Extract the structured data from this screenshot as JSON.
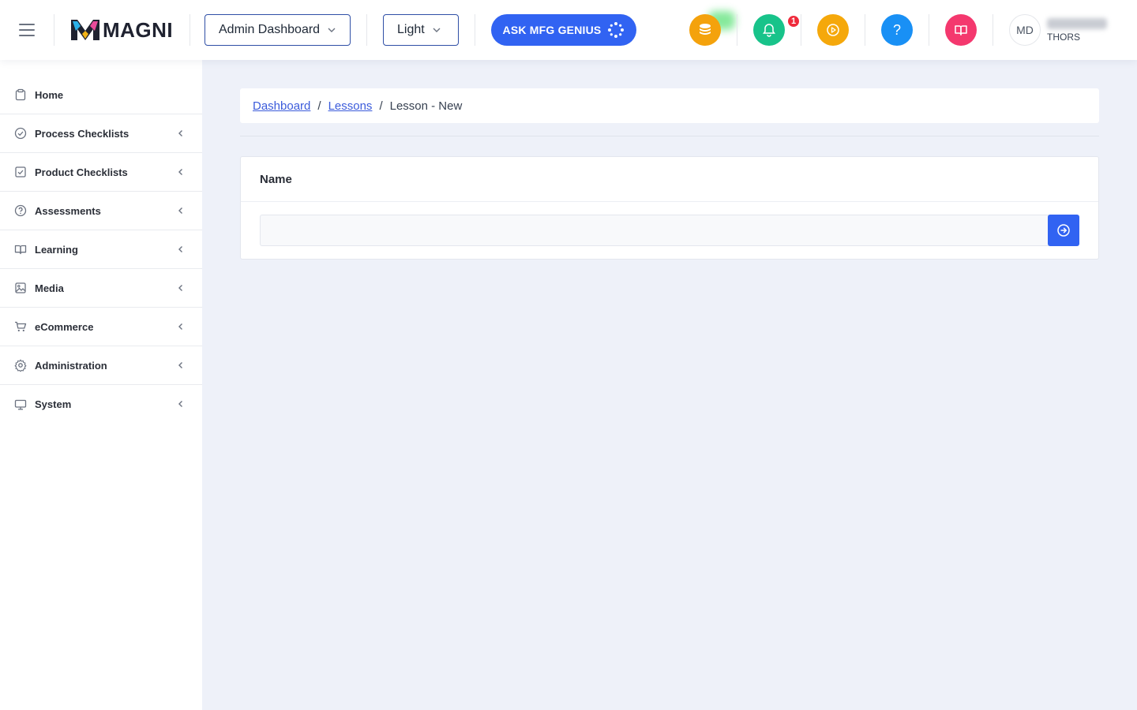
{
  "header": {
    "logo_text": "MAGNI",
    "dashboard_select": "Admin Dashboard",
    "theme_select": "Light",
    "ask_button": "ASK MFG GENIUS",
    "notification_count": "1",
    "help_glyph": "?",
    "user": {
      "initials": "MD",
      "org": "THORS"
    },
    "colors": {
      "coins": "#f4a20c",
      "bell": "#18c38a",
      "play": "#f5a80b",
      "help": "#1990f5",
      "book": "#f4386e",
      "accent": "#3163f2"
    }
  },
  "sidebar": {
    "items": [
      {
        "label": "Home",
        "icon": "clipboard-icon"
      },
      {
        "label": "Process Checklists",
        "icon": "check-circle-icon"
      },
      {
        "label": "Product Checklists",
        "icon": "check-square-icon"
      },
      {
        "label": "Assessments",
        "icon": "question-circle-icon"
      },
      {
        "label": "Learning",
        "icon": "book-open-icon"
      },
      {
        "label": "Media",
        "icon": "image-icon"
      },
      {
        "label": "eCommerce",
        "icon": "cart-icon"
      },
      {
        "label": "Administration",
        "icon": "gear-icon"
      },
      {
        "label": "System",
        "icon": "monitor-icon"
      }
    ]
  },
  "breadcrumb": {
    "items": [
      "Dashboard",
      "Lessons"
    ],
    "current": "Lesson - New",
    "separator": "/"
  },
  "form": {
    "title": "Name",
    "name_value": "",
    "name_placeholder": ""
  }
}
